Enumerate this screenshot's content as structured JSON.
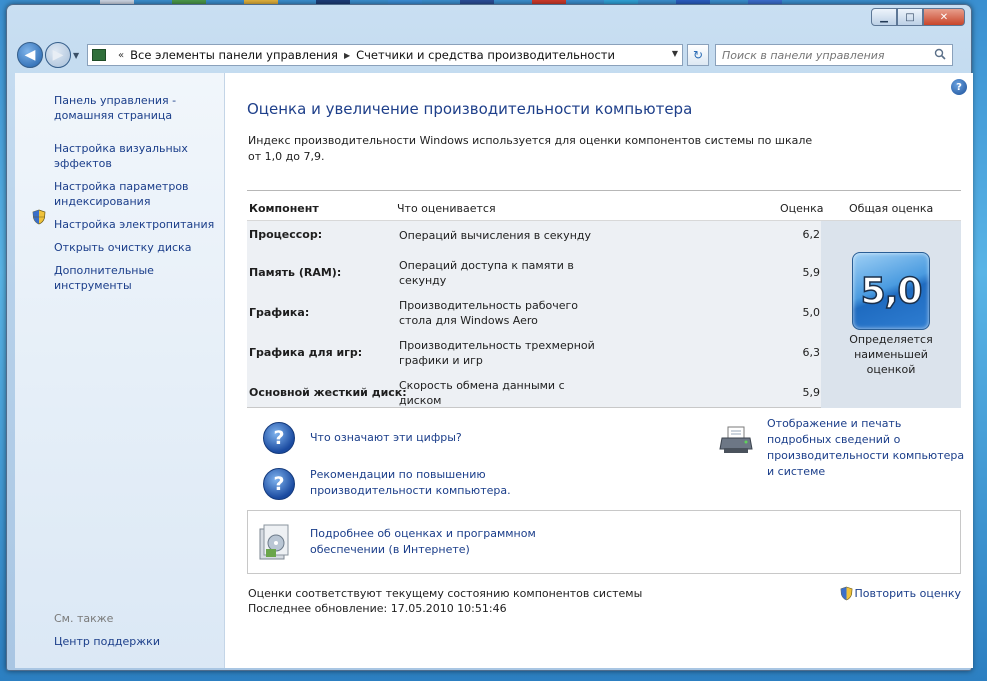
{
  "window": {
    "minimize_glyph": "▁",
    "maximize_glyph": "□",
    "close_glyph": "✕"
  },
  "navbar": {
    "back_glyph": "◀",
    "forward_glyph": "▶",
    "breadcrumb_sep": "«",
    "crumb_1": "Все элементы панели управления",
    "crumb_sep_2": "▶",
    "crumb_2": "Счетчики и средства производительности",
    "refresh_glyph": "↻",
    "search_placeholder": "Поиск в панели управления"
  },
  "sidebar": {
    "home_link": "Панель управления - домашняя страница",
    "items": [
      "Настройка визуальных эффектов",
      "Настройка параметров индексирования",
      "Настройка электропитания",
      "Открыть очистку диска",
      "Дополнительные инструменты"
    ],
    "see_also_label": "См. также",
    "support_center": "Центр поддержки"
  },
  "main": {
    "title": "Оценка и увеличение производительности компьютера",
    "intro": "Индекс производительности Windows используется для оценки компонентов системы по шкале от 1,0 до 7,9.",
    "help_glyph": "?",
    "table": {
      "headers": {
        "component": "Компонент",
        "rated": "Что оценивается",
        "score": "Оценка",
        "overall": "Общая оценка"
      },
      "rows": [
        {
          "component": "Процессор:",
          "desc": "Операций вычисления в секунду",
          "score": "6,2"
        },
        {
          "component": "Память (RAM):",
          "desc": "Операций доступа к памяти в секунду",
          "score": "5,9"
        },
        {
          "component": "Графика:",
          "desc": "Производительность рабочего стола для Windows Aero",
          "score": "5,0"
        },
        {
          "component": "Графика для игр:",
          "desc": "Производительность трехмерной графики и игр",
          "score": "6,3"
        },
        {
          "component": "Основной жесткий диск:",
          "desc": "Скорость обмена данными с диском",
          "score": "5,9"
        }
      ],
      "overall_score": "5,0",
      "overall_note": "Определяется наименьшей оценкой"
    },
    "links": {
      "what_numbers": "Что означают эти цифры?",
      "tips": "Рекомендации по повышению производительности компьютера.",
      "print_details": "Отображение и печать подробных сведений о производительности компьютера и системе",
      "online_info": "Подробнее об оценках и программном обеспечении (в Интернете)"
    },
    "question_glyph": "?",
    "status_line_1": "Оценки соответствуют текущему состоянию компонентов системы",
    "status_line_2": "Последнее обновление: 17.05.2010 10:51:46",
    "rerun_label": "Повторить оценку"
  }
}
